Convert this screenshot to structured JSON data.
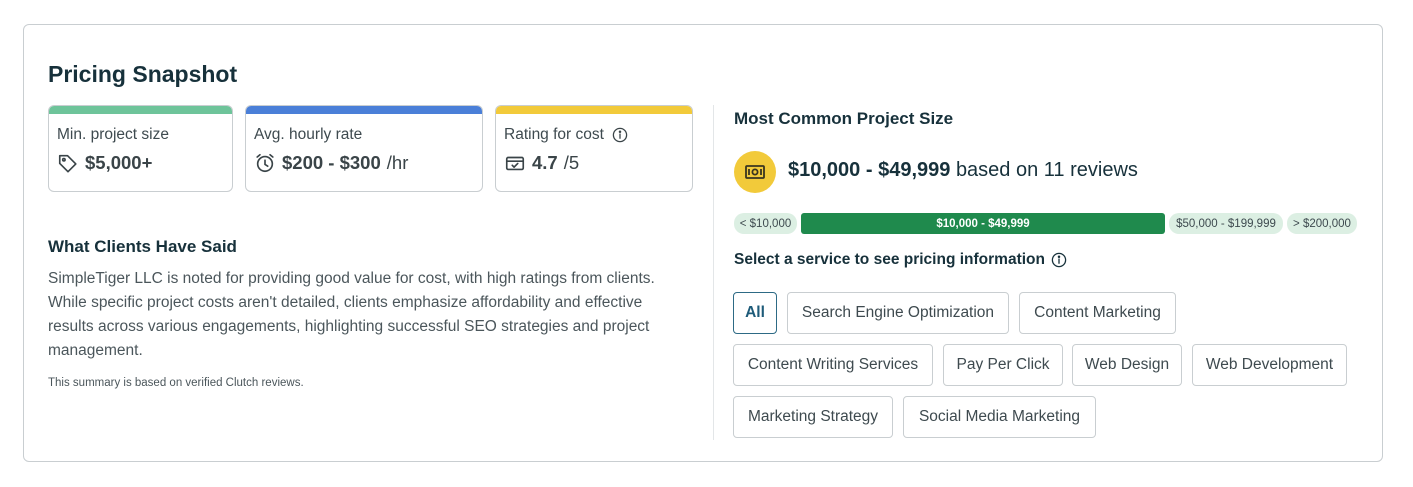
{
  "section": {
    "title": "Pricing Snapshot"
  },
  "stats": {
    "min_project": {
      "label": "Min. project size",
      "value": "$5,000+",
      "icon": "tag-icon",
      "color": "#6ec49a"
    },
    "hourly": {
      "label": "Avg. hourly rate",
      "value": "$200 - $300",
      "unit": "/hr",
      "icon": "clock-icon",
      "color": "#4a7fd8"
    },
    "cost_rating": {
      "label": "Rating for cost",
      "value": "4.7",
      "unit": "/5",
      "icon": "wallet-icon",
      "color": "#f2ca3a"
    }
  },
  "clients": {
    "heading": "What Clients Have Said",
    "summary": "SimpleTiger LLC is noted for providing good value for cost, with high ratings from clients. While specific project costs aren't detailed, clients emphasize affordability and effective results across various engagements, highlighting successful SEO strategies and project management.",
    "note": "This summary is based on verified Clutch reviews."
  },
  "project_size": {
    "heading": "Most Common Project Size",
    "range": "$10,000 - $49,999",
    "suffix": "based on 11 reviews",
    "segments": [
      {
        "label": "< $10,000",
        "active": false
      },
      {
        "label": "$10,000 - $49,999",
        "active": true
      },
      {
        "label": "$50,000 - $199,999",
        "active": false
      },
      {
        "label": "> $200,000",
        "active": false
      }
    ]
  },
  "services": {
    "heading": "Select a service to see pricing information",
    "selected": "All",
    "options": [
      "All",
      "Search Engine Optimization",
      "Content Marketing",
      "Content Writing Services",
      "Pay Per Click",
      "Web Design",
      "Web Development",
      "Marketing Strategy",
      "Social Media Marketing"
    ]
  }
}
